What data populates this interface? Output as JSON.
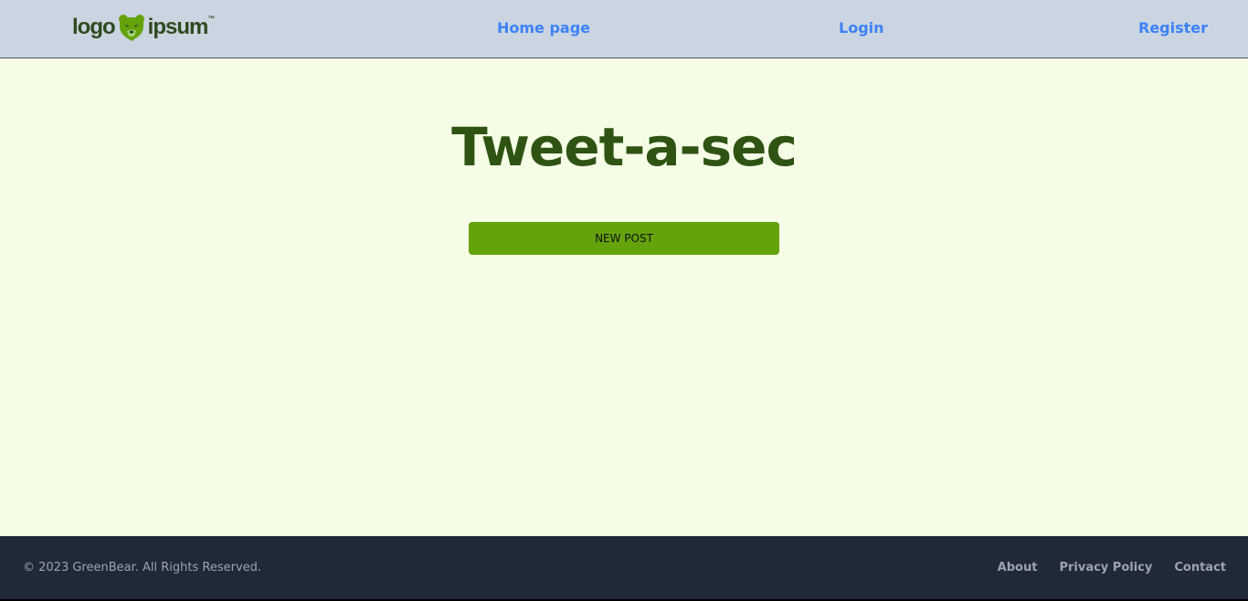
{
  "header": {
    "logo": {
      "text_left": "logo",
      "text_right": "ipsum",
      "trademark": "™",
      "icon": "bear-head-icon",
      "color": "#2f4a1f",
      "icon_color": "#65a30d"
    },
    "nav": {
      "home": "Home page",
      "login": "Login",
      "register": "Register"
    },
    "background": "#cbd5e1",
    "link_color": "#3b82f6"
  },
  "main": {
    "title": "Tweet-a-sec",
    "new_post_label": "NEW POST",
    "background": "#f5fde6",
    "title_color": "#2f5313",
    "button_color": "#65a30d"
  },
  "footer": {
    "copyright": "© 2023 GreenBear. All Rights Reserved.",
    "links": {
      "about": "About",
      "privacy": "Privacy Policy",
      "contact": "Contact"
    },
    "background": "#1f2937",
    "text_color": "#9ca3af"
  }
}
